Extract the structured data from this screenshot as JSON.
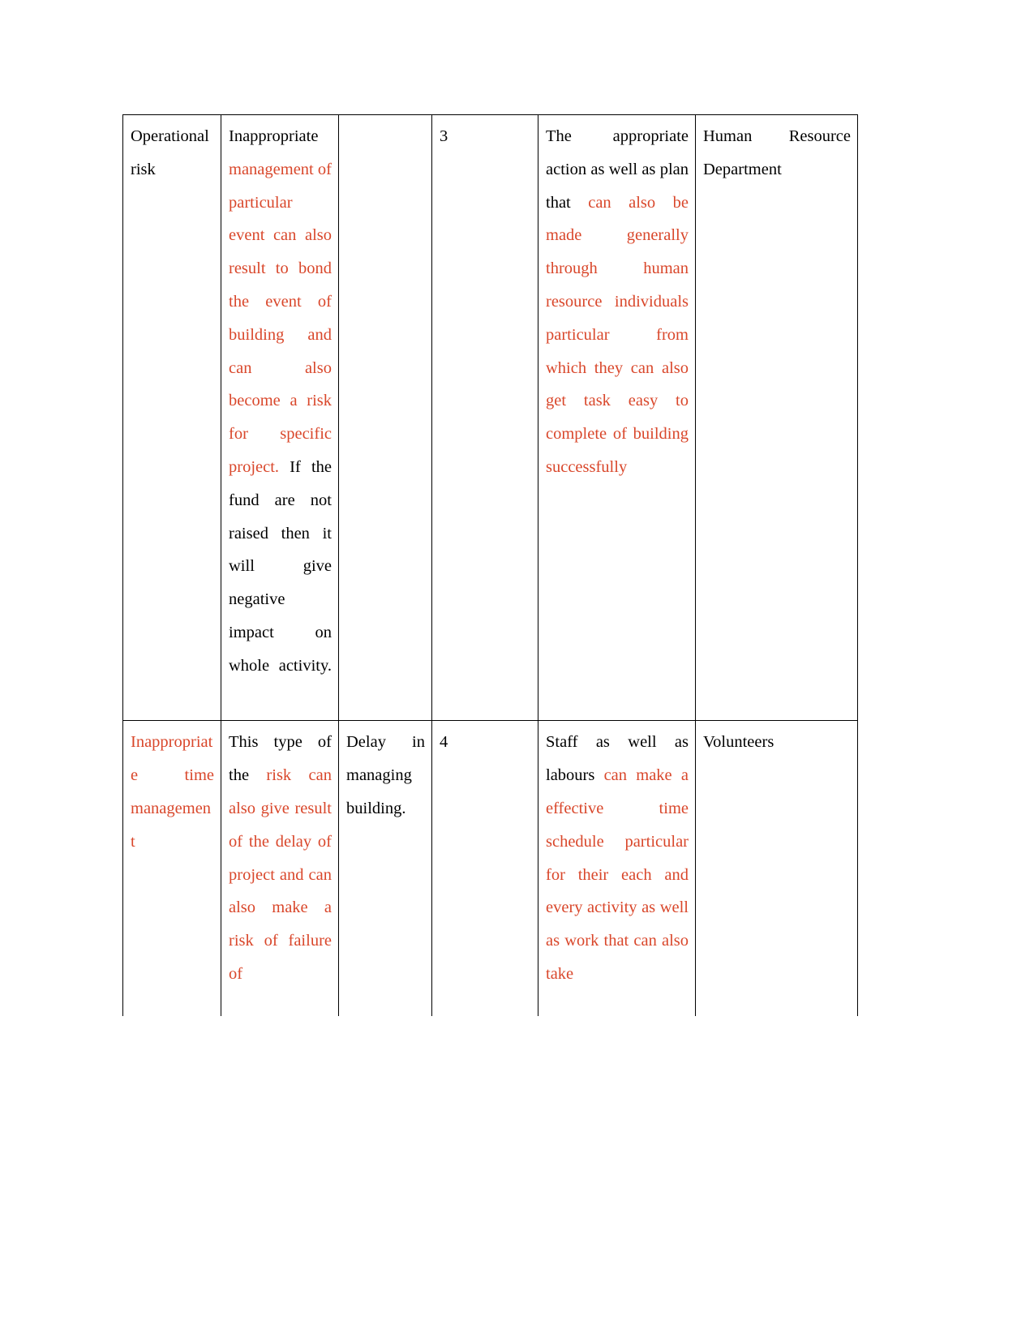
{
  "document": {
    "type": "risk-register-table",
    "page_background": "#ffffff",
    "text_color_normal": "#000000",
    "text_color_revision": "#D9472B"
  },
  "table": {
    "columns": [
      {
        "name": "risk-category"
      },
      {
        "name": "risk-description"
      },
      {
        "name": "risk-impact"
      },
      {
        "name": "risk-rating"
      },
      {
        "name": "mitigation-action"
      },
      {
        "name": "responsible-party"
      }
    ],
    "rows": [
      {
        "category": {
          "black_1": "Operational risk",
          "red_1": "",
          "black_2": ""
        },
        "description": {
          "black_1": "Inappropriate ",
          "red_1": "management of particular event can also result to bond the event of building and can also become a risk for specific project. ",
          "black_2": "If the fund are not raised then it will give negative impact on whole activity."
        },
        "impact": "",
        "rating": "3",
        "mitigation": {
          "black_1": "The appropriate action as well as plan that ",
          "red_1": "can also be made generally through human resource individuals particular from which they can also get task easy to complete of building successfully",
          "black_2": ""
        },
        "responsible": "Human Resource Department"
      },
      {
        "category": {
          "black_1": "",
          "red_1": "Inappropriate time management",
          "black_2": ""
        },
        "description": {
          "black_1": "This type of the ",
          "red_1": "risk can also give result of the delay of project and can also make a risk of failure of",
          "black_2": ""
        },
        "impact": "Delay in managing building.",
        "rating": "4",
        "mitigation": {
          "black_1": "Staff as well as labours ",
          "red_1": "can make a effective time schedule particular for their each and every activity as well as work that can also take",
          "black_2": ""
        },
        "responsible": "Volunteers"
      }
    ]
  }
}
